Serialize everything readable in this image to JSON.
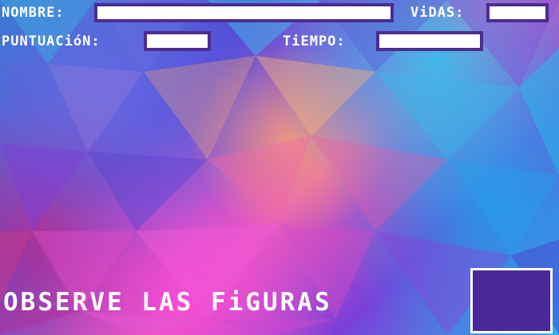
{
  "hud": {
    "name_label": "NOMBRE:",
    "name_value": "",
    "lives_label": "ViDAS:",
    "lives_value": "",
    "score_label": "PUNTUACióN:",
    "score_value": "",
    "time_label": "TiEMPO:",
    "time_value": ""
  },
  "main": {
    "instruction": "OBSERVE LAS FiGURAS",
    "figure_box_color": "#4a2a9a"
  },
  "colors": {
    "field_border": "#4b2d8f",
    "field_fill": "#ffffff",
    "text": "#ffffff"
  }
}
